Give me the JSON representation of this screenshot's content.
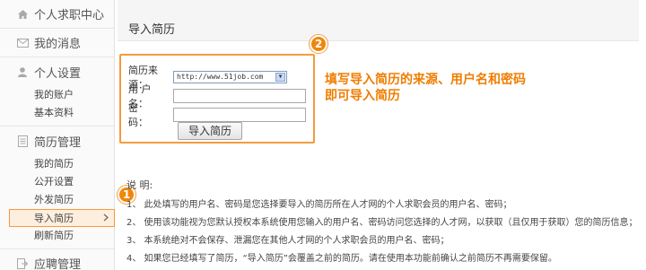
{
  "sidebar": {
    "header_item": "个人求职中心",
    "messages": "我的消息",
    "groups": [
      {
        "title": "个人设置",
        "items": [
          "我的账户",
          "基本资料"
        ]
      },
      {
        "title": "简历管理",
        "items": [
          "我的简历",
          "公开设置",
          "外发简历",
          "导入简历",
          "刷新简历"
        ]
      }
    ],
    "bottom_item": "应聘管理",
    "active_item": "导入简历"
  },
  "main": {
    "title": "导入简历",
    "form": {
      "source_label": "简历来源：",
      "source_value": "http://www.51job.com",
      "username_label": "用 户 名：",
      "password_label": "密　　码：",
      "submit_label": "导入简历"
    },
    "badge1": "1",
    "badge2": "2",
    "callout_line1": "填写导入简历的来源、用户名和密码",
    "callout_line2": "即可导入简历",
    "notes_title": "说 明:",
    "notes": [
      "1、 此处填写的用户名、密码是您选择要导入的简历所在人才网的个人求职会员的用户名、密码；",
      "2、 使用该功能视为您默认授权本系统使用您输入的用户名、密码访问您选择的人才网，以获取（且仅用于获取）您的简历信息；",
      "3、 本系统绝对不会保存、泄漏您在其他人才网的个人求职会员的用户名、密码；",
      "4、 如果您已经填写了简历，“导入简历”会覆盖之前的简历。请在使用本功能前确认之前简历不再需要保留。"
    ]
  }
}
